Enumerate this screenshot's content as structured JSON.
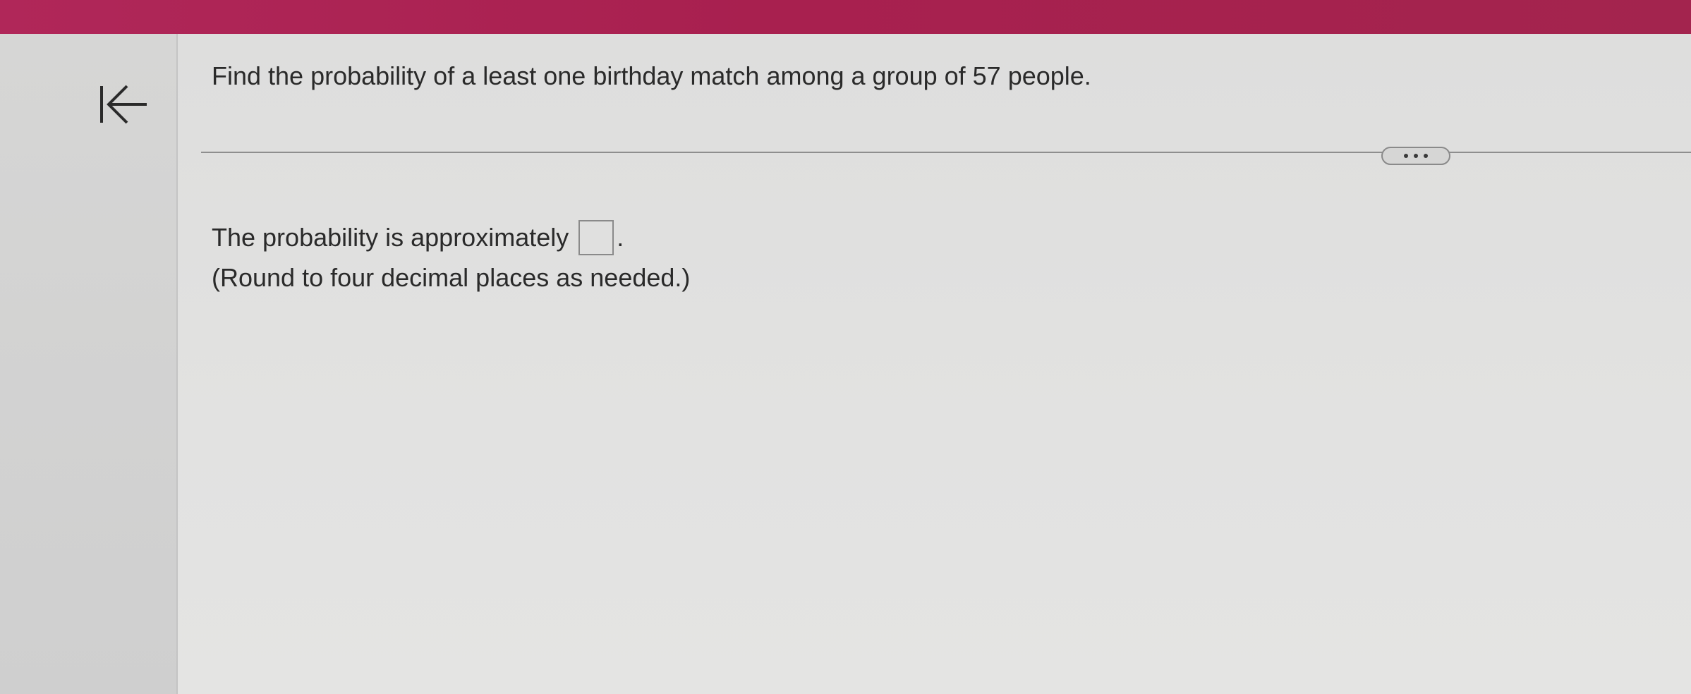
{
  "question": {
    "text": "Find the probability of a least one birthday match among a group of 57 people."
  },
  "answer": {
    "prefix": "The probability is approximately",
    "value": "",
    "suffix": ".",
    "instruction": "(Round to four decimal places as needed.)"
  },
  "icons": {
    "back": "arrow-left-to-bar-icon",
    "more": "ellipsis-icon"
  },
  "colors": {
    "top_bar": "#a8204f",
    "background": "#dededd",
    "text": "#2a2a2a"
  }
}
